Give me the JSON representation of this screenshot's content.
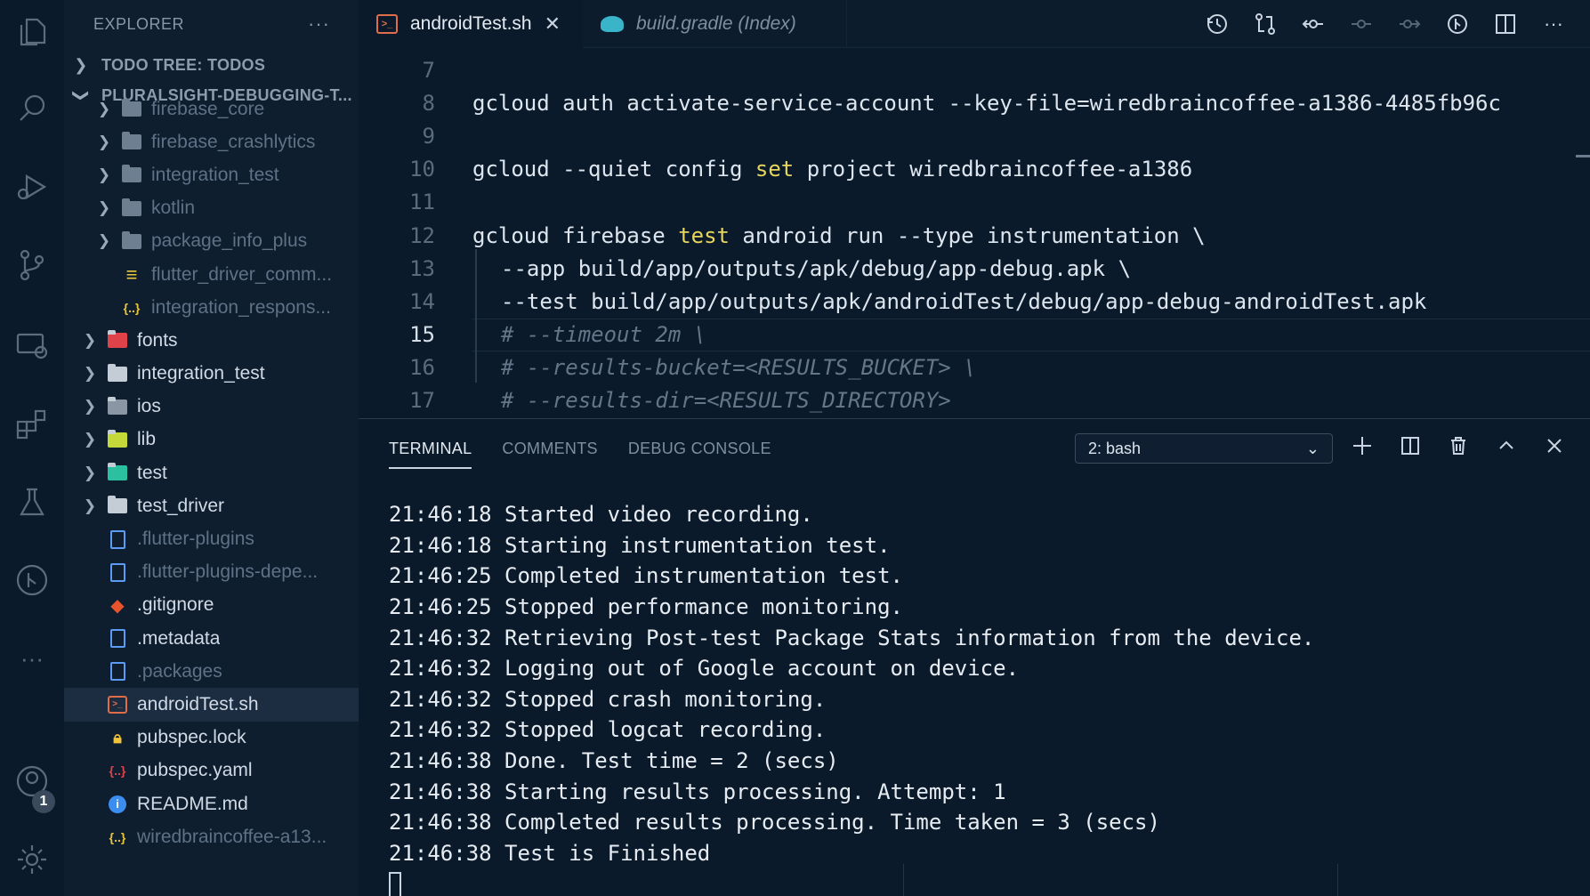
{
  "sidebar": {
    "header": "EXPLORER",
    "more": "···",
    "todo_section": "TODO TREE: TODOS",
    "project_section": "PLURALSIGHT-DEBUGGING-T...",
    "items": [
      {
        "label": "firebase_core",
        "type": "folder",
        "level": 2,
        "dim": true
      },
      {
        "label": "firebase_crashlytics",
        "type": "folder",
        "level": 2,
        "dim": true
      },
      {
        "label": "integration_test",
        "type": "folder",
        "level": 2,
        "dim": true
      },
      {
        "label": "kotlin",
        "type": "folder",
        "level": 2,
        "dim": true
      },
      {
        "label": "package_info_plus",
        "type": "folder",
        "level": 2,
        "dim": true
      },
      {
        "label": "flutter_driver_comm...",
        "type": "file-lines",
        "level": 2,
        "dim": true
      },
      {
        "label": "integration_respons...",
        "type": "json",
        "level": 2,
        "dim": true
      },
      {
        "label": "fonts",
        "type": "folder-fonts",
        "level": 1,
        "dim": false
      },
      {
        "label": "integration_test",
        "type": "folder",
        "level": 1,
        "dim": false
      },
      {
        "label": "ios",
        "type": "folder-ios",
        "level": 1,
        "dim": false
      },
      {
        "label": "lib",
        "type": "folder-lib",
        "level": 1,
        "dim": false
      },
      {
        "label": "test",
        "type": "folder-test",
        "level": 1,
        "dim": false
      },
      {
        "label": "test_driver",
        "type": "folder",
        "level": 1,
        "dim": false
      },
      {
        "label": ".flutter-plugins",
        "type": "file",
        "level": 1,
        "dim": true
      },
      {
        "label": ".flutter-plugins-depe...",
        "type": "file",
        "level": 1,
        "dim": true
      },
      {
        "label": ".gitignore",
        "type": "git",
        "level": 1,
        "dim": false
      },
      {
        "label": ".metadata",
        "type": "file",
        "level": 1,
        "dim": false
      },
      {
        "label": ".packages",
        "type": "file",
        "level": 1,
        "dim": true
      },
      {
        "label": "androidTest.sh",
        "type": "shell",
        "level": 1,
        "dim": false,
        "selected": true
      },
      {
        "label": "pubspec.lock",
        "type": "lock",
        "level": 1,
        "dim": false
      },
      {
        "label": "pubspec.yaml",
        "type": "yaml",
        "level": 1,
        "dim": false
      },
      {
        "label": "README.md",
        "type": "info",
        "level": 1,
        "dim": false
      },
      {
        "label": "wiredbraincoffee-a13...",
        "type": "json",
        "level": 1,
        "dim": true
      }
    ]
  },
  "activity": {
    "badge": "1"
  },
  "tabs": [
    {
      "label": "androidTest.sh",
      "active": true,
      "close": "✕"
    },
    {
      "label": "build.gradle (Index)",
      "active": false
    }
  ],
  "editor": {
    "lines": [
      {
        "n": "7",
        "text": ""
      },
      {
        "n": "8",
        "text": "gcloud auth activate-service-account --key-file=wiredbraincoffee-a1386-4485fb96c"
      },
      {
        "n": "9",
        "text": ""
      },
      {
        "n": "10",
        "pre": "gcloud --quiet config ",
        "kw": "set",
        "post": " project wiredbraincoffee-a1386"
      },
      {
        "n": "11",
        "text": ""
      },
      {
        "n": "12",
        "pre": "gcloud firebase ",
        "kw": "test",
        "post": " android run --type instrumentation \\"
      },
      {
        "n": "13",
        "text": "--app build/app/outputs/apk/debug/app-debug.apk \\",
        "indent": true
      },
      {
        "n": "14",
        "text": "--test build/app/outputs/apk/androidTest/debug/app-debug-androidTest.apk",
        "indent": true
      },
      {
        "n": "15",
        "text": "# --timeout 2m \\",
        "indent": true,
        "comment": true,
        "current": true
      },
      {
        "n": "16",
        "text": "# --results-bucket=<RESULTS_BUCKET> \\",
        "indent": true,
        "comment": true
      },
      {
        "n": "17",
        "text": "# --results-dir=<RESULTS_DIRECTORY>",
        "indent": true,
        "comment": true
      }
    ]
  },
  "panel": {
    "tabs": [
      "TERMINAL",
      "COMMENTS",
      "DEBUG CONSOLE"
    ],
    "terminal_select": "2: bash",
    "output": [
      "21:46:18 Started video recording.",
      "21:46:18 Starting instrumentation test.",
      "21:46:25 Completed instrumentation test.",
      "21:46:25 Stopped performance monitoring.",
      "21:46:32 Retrieving Post-test Package Stats information from the device.",
      "21:46:32 Logging out of Google account on device.",
      "21:46:32 Stopped crash monitoring.",
      "21:46:32 Stopped logcat recording.",
      "21:46:38 Done. Test time = 2 (secs)",
      "21:46:38 Starting results processing. Attempt: 1",
      "21:46:38 Completed results processing. Time taken = 3 (secs)",
      "21:46:38 Test is Finished"
    ]
  },
  "colors": {
    "background": "#0b1a2a",
    "keyword": "#e7d65c",
    "comment": "#66768a",
    "accent": "#e06d4a"
  }
}
